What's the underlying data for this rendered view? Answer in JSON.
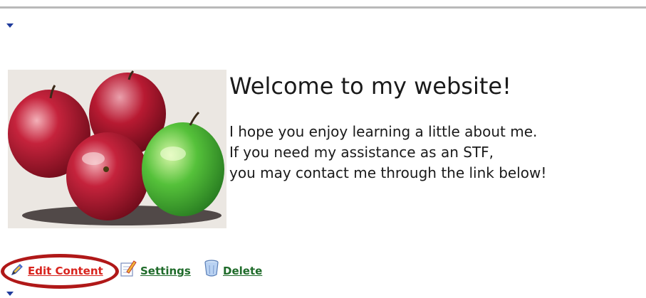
{
  "content": {
    "heading": "Welcome to my website!",
    "lines": [
      "I hope you enjoy learning a little about me.",
      "If you need my assistance as an STF,",
      "you may contact me through the link below!"
    ]
  },
  "image": {
    "subject": "apples-illustration"
  },
  "actions": {
    "edit_label": "Edit Content",
    "settings_label": "Settings",
    "delete_label": "Delete"
  },
  "icons": {
    "edit": "pencil-icon",
    "settings": "settings-icon",
    "delete": "trash-icon",
    "collapse": "triangle-down-icon"
  },
  "colors": {
    "edit_link": "#d8241e",
    "action_link": "#1f6b2a",
    "highlight_ring": "#b01818",
    "marker": "#1f3b9c"
  }
}
